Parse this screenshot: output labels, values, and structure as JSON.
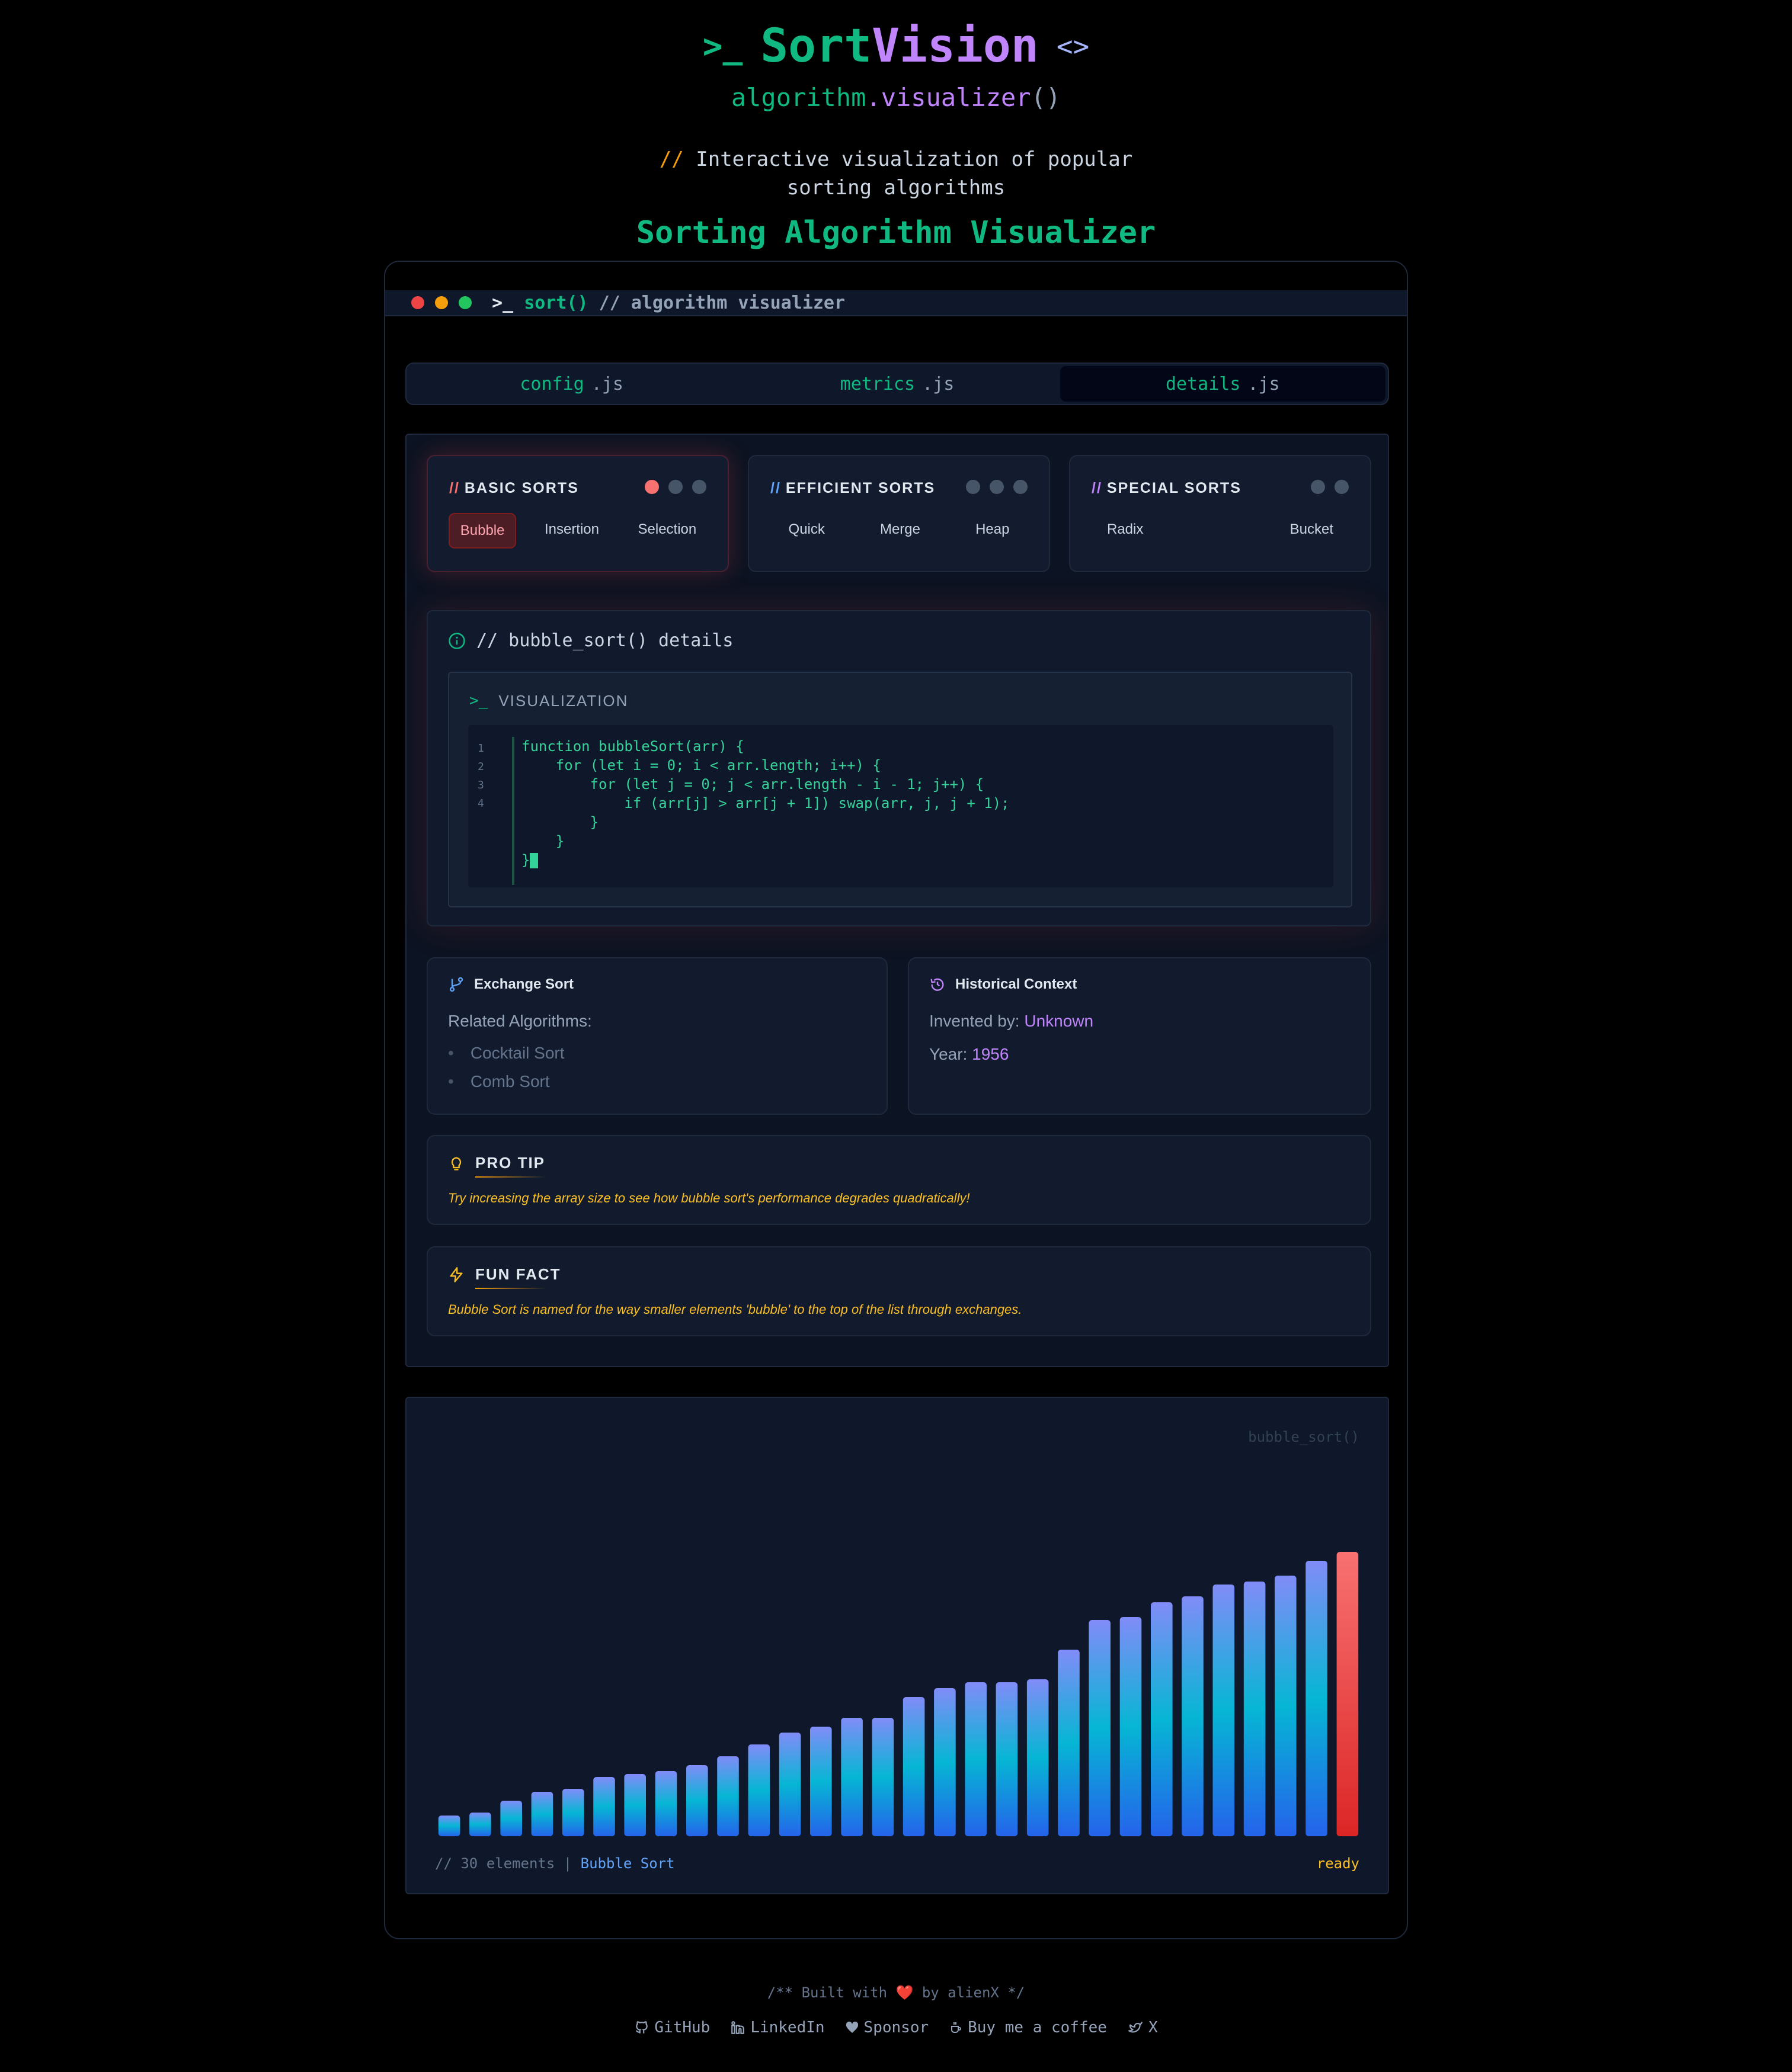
{
  "header": {
    "brand_prompt": ">_",
    "brand_sort": "Sort",
    "brand_vision": "Vision",
    "brand_icon": "<>",
    "subtitle_a": "algorithm",
    "subtitle_b": ".visualizer",
    "subtitle_c": "()",
    "desc_slash": "//",
    "desc_line1": "Interactive visualization of popular",
    "desc_line2": "sorting algorithms",
    "title": "Sorting Algorithm Visualizer"
  },
  "window": {
    "title_prompt": ">_",
    "title_fn": "sort()",
    "title_comment": "// algorithm visualizer"
  },
  "tabs": [
    {
      "name": "config",
      "ext": ".js"
    },
    {
      "name": "metrics",
      "ext": ".js"
    },
    {
      "name": "details",
      "ext": ".js"
    }
  ],
  "groups": [
    {
      "slash": "//",
      "label": "BASIC SORTS",
      "color": "#f87171",
      "items": [
        "Bubble",
        "Insertion",
        "Selection"
      ]
    },
    {
      "slash": "//",
      "label": "EFFICIENT SORTS",
      "color": "#60a5fa",
      "items": [
        "Quick",
        "Merge",
        "Heap"
      ]
    },
    {
      "slash": "//",
      "label": "SPECIAL SORTS",
      "color": "#c084fc",
      "items": [
        "Radix",
        "Bucket"
      ]
    }
  ],
  "details": {
    "heading": "// bubble_sort() details",
    "viz_prompt": ">_",
    "viz_label": "VISUALIZATION",
    "line_numbers": "1\n2\n3\n4",
    "code": "function bubbleSort(arr) {\n    for (let i = 0; i < arr.length; i++) {\n        for (let j = 0; j < arr.length - i - 1; j++) {\n            if (arr[j] > arr[j + 1]) swap(arr, j, j + 1);\n        }\n    }\n}"
  },
  "exchange": {
    "title": "Exchange Sort",
    "related_label": "Related Algorithms:",
    "related": [
      "Cocktail Sort",
      "Comb Sort"
    ]
  },
  "history": {
    "title": "Historical Context",
    "invented_label": "Invented by: ",
    "invented_value": "Unknown",
    "year_label": "Year: ",
    "year_value": "1956"
  },
  "pro_tip": {
    "title": "PRO TIP",
    "text": "Try increasing the array size to see how bubble sort's performance degrades quadratically!"
  },
  "fun_fact": {
    "title": "FUN FACT",
    "text": "Bubble Sort is named for the way smaller elements 'bubble' to the top of the list through exchanges."
  },
  "chart_meta": {
    "watermark": "bubble_sort()",
    "footer_prefix": "// 30 elements |",
    "footer_algo": "Bubble Sort",
    "status": "ready"
  },
  "chart_data": {
    "type": "bar",
    "values": [
      7,
      8,
      12,
      15,
      16,
      20,
      21,
      22,
      24,
      27,
      31,
      35,
      37,
      40,
      40,
      47,
      50,
      52,
      52,
      53,
      63,
      73,
      74,
      79,
      81,
      85,
      86,
      88,
      93,
      96
    ],
    "highlight_index": 29,
    "colors": {
      "bar_top": "#818cf8",
      "bar_mid": "#06b6d4",
      "bar_bottom": "#2563eb",
      "highlight": "#ef4444"
    }
  },
  "footer": {
    "built": "/** Built with ❤️ by alienX */",
    "links": [
      "GitHub",
      "LinkedIn",
      "Sponsor",
      "Buy me a coffee",
      "X"
    ]
  }
}
